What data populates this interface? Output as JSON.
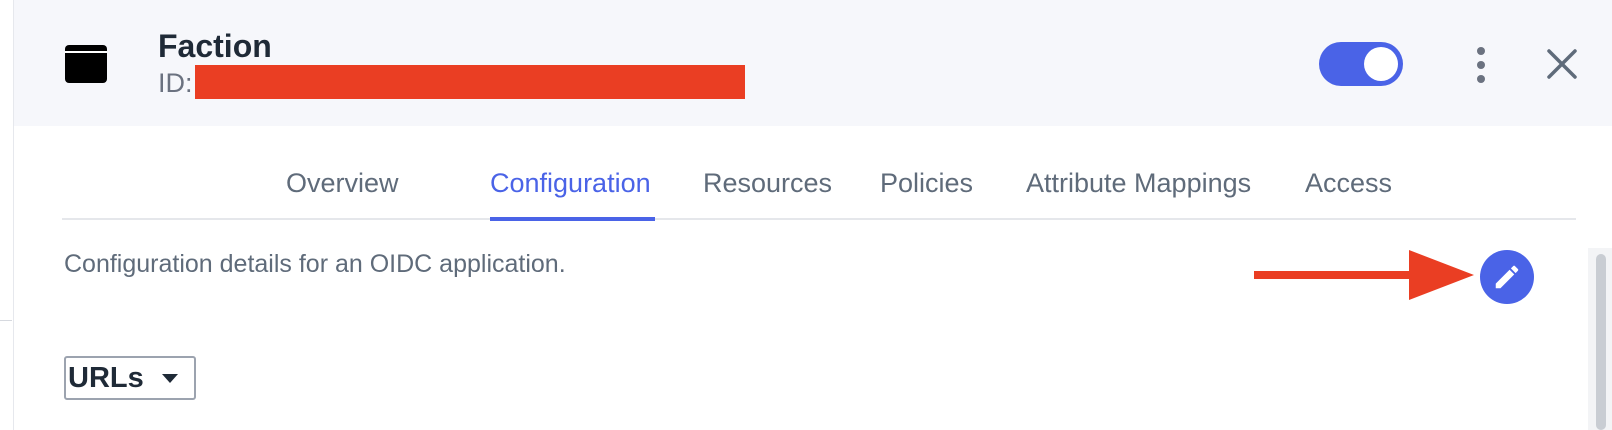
{
  "header": {
    "title": "Faction",
    "id_label": "ID:",
    "enabled": true
  },
  "tabs": [
    {
      "label": "Overview",
      "active": false
    },
    {
      "label": "Configuration",
      "active": true
    },
    {
      "label": "Resources",
      "active": false
    },
    {
      "label": "Policies",
      "active": false
    },
    {
      "label": "Attribute Mappings",
      "active": false
    },
    {
      "label": "Access",
      "active": false
    }
  ],
  "main": {
    "description": "Configuration details for an OIDC application.",
    "section_dropdown": "URLs"
  },
  "icons": {
    "app": "app-window-icon",
    "more": "kebab-menu-icon",
    "close": "close-icon",
    "edit": "pencil-icon",
    "annotation": "red-arrow-icon"
  },
  "colors": {
    "accent": "#4a63e7",
    "redaction": "#ea3e23",
    "header_bg": "#f6f7fb"
  }
}
